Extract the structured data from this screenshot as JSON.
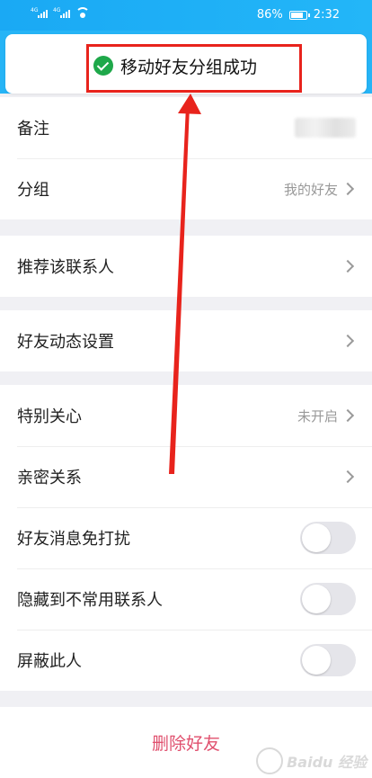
{
  "status_bar": {
    "battery": "86%",
    "battery_level": 0.86,
    "time": "2:32",
    "signal_tag": "4G"
  },
  "toast": {
    "message": "移动好友分组成功",
    "icon": "check-circle-icon"
  },
  "settings": {
    "group1": [
      {
        "label": "备注",
        "value": ""
      },
      {
        "label": "分组",
        "value": "我的好友"
      }
    ],
    "group2": [
      {
        "label": "推荐该联系人"
      }
    ],
    "group3": [
      {
        "label": "好友动态设置"
      }
    ],
    "group4": [
      {
        "label": "特别关心",
        "value": "未开启"
      },
      {
        "label": "亲密关系"
      },
      {
        "label": "好友消息免打扰",
        "toggle": false
      },
      {
        "label": "隐藏到不常用联系人",
        "toggle": false
      },
      {
        "label": "屏蔽此人",
        "toggle": false
      }
    ]
  },
  "delete_button": {
    "label": "删除好友"
  },
  "colors": {
    "status_bar": "#1aa9f4",
    "annotation_red": "#e8231c",
    "delete_text": "#e0506e",
    "success_green": "#1ea84a"
  },
  "watermark": {
    "text": "Baidu 经验"
  }
}
